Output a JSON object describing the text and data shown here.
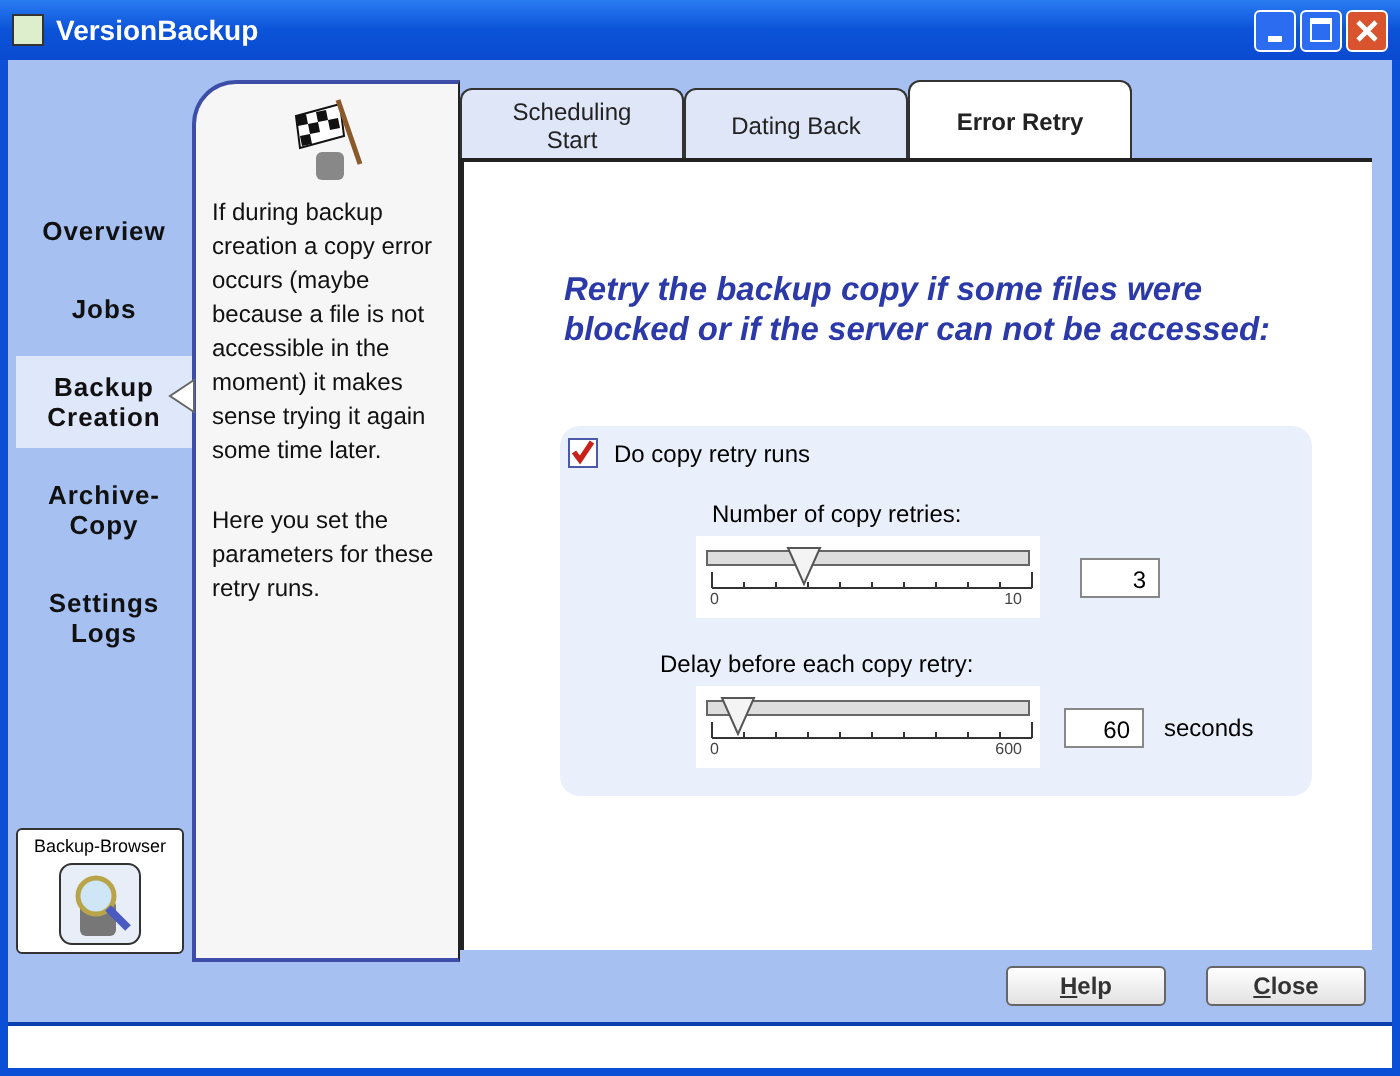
{
  "window": {
    "title": "VersionBackup"
  },
  "nav": [
    {
      "label": "Overview",
      "selected": false
    },
    {
      "label": "Jobs",
      "selected": false
    },
    {
      "label": "Backup Creation",
      "selected": true
    },
    {
      "label": "Archive-Copy",
      "selected": false
    },
    {
      "label": "Settings Logs",
      "selected": false
    }
  ],
  "backup_browser": {
    "label": "Backup-Browser"
  },
  "info": {
    "paragraphs": [
      "If during backup creation a copy error occurs (maybe because a file is not accessible in the moment) it makes sense trying it again some time later.",
      "Here you set the parameters for these retry runs."
    ]
  },
  "tabs": [
    {
      "label": "Scheduling Start",
      "selected": false
    },
    {
      "label": "Dating Back",
      "selected": false
    },
    {
      "label": "Error Retry",
      "selected": true
    }
  ],
  "heading": "Retry the backup copy if some files were blocked or if the server can not be accessed:",
  "retry": {
    "label": "Do copy retry runs",
    "checked": true
  },
  "sliders": [
    {
      "label": "Number of copy retries:",
      "level": 0.3,
      "min": "0",
      "max": "10",
      "value": "3"
    },
    {
      "label": "Delay  before each copy retry:",
      "level": 0.1,
      "min": "0",
      "max": "600",
      "value": "60",
      "unit": "seconds"
    }
  ],
  "buttons": [
    "Help",
    "Close"
  ]
}
